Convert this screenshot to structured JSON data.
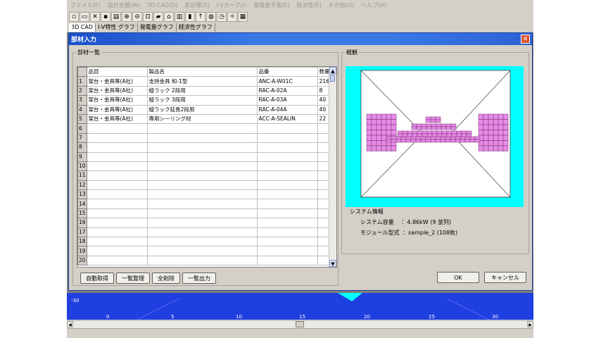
{
  "menu": [
    "ファイル(F)",
    "設計支援(W)",
    "3D CAD(D)",
    "影計算(S)",
    "I-Vカーブ(I)",
    "発電量予測(E)",
    "経済性(E)",
    "その他(O)",
    "ヘルプ(H)"
  ],
  "tabs": [
    "3D CAD",
    "I-V特性 グラフ",
    "発電量グラフ",
    "経済性グラフ"
  ],
  "dialog": {
    "title": "部材入力",
    "close_glyph": "✕",
    "parts_legend": "部材一覧",
    "overview_legend": "概観",
    "columns": [
      "品目",
      "製品名",
      "品番",
      "数量"
    ],
    "rows": [
      {
        "no": "1",
        "item": "架台・金具等(A社)",
        "name": "支持金具 和-1型",
        "code": "ANC-A-W01C",
        "qty": "216"
      },
      {
        "no": "2",
        "item": "架台・金具等(A社)",
        "name": "縦ラック 2段用",
        "code": "RAC-A-02A",
        "qty": "8"
      },
      {
        "no": "3",
        "item": "架台・金具等(A社)",
        "name": "縦ラック 3段用",
        "code": "RAC-A-03A",
        "qty": "40"
      },
      {
        "no": "4",
        "item": "架台・金具等(A社)",
        "name": "縦ラック延長2段用",
        "code": "RAC-A-04A",
        "qty": "40"
      },
      {
        "no": "5",
        "item": "架台・金具等(A社)",
        "name": "専用シーリング材",
        "code": "ACC-A-SEALIN",
        "qty": "22"
      },
      {
        "no": "6",
        "item": "",
        "name": "",
        "code": "",
        "qty": ""
      },
      {
        "no": "7",
        "item": "",
        "name": "",
        "code": "",
        "qty": ""
      },
      {
        "no": "8",
        "item": "",
        "name": "",
        "code": "",
        "qty": ""
      },
      {
        "no": "9",
        "item": "",
        "name": "",
        "code": "",
        "qty": ""
      },
      {
        "no": "10",
        "item": "",
        "name": "",
        "code": "",
        "qty": ""
      },
      {
        "no": "11",
        "item": "",
        "name": "",
        "code": "",
        "qty": ""
      },
      {
        "no": "12",
        "item": "",
        "name": "",
        "code": "",
        "qty": ""
      },
      {
        "no": "13",
        "item": "",
        "name": "",
        "code": "",
        "qty": ""
      },
      {
        "no": "14",
        "item": "",
        "name": "",
        "code": "",
        "qty": ""
      },
      {
        "no": "15",
        "item": "",
        "name": "",
        "code": "",
        "qty": ""
      },
      {
        "no": "16",
        "item": "",
        "name": "",
        "code": "",
        "qty": ""
      },
      {
        "no": "17",
        "item": "",
        "name": "",
        "code": "",
        "qty": ""
      },
      {
        "no": "18",
        "item": "",
        "name": "",
        "code": "",
        "qty": ""
      },
      {
        "no": "19",
        "item": "",
        "name": "",
        "code": "",
        "qty": ""
      },
      {
        "no": "20",
        "item": "",
        "name": "",
        "code": "",
        "qty": ""
      }
    ],
    "buttons": {
      "auto": "自動取得",
      "sort": "一覧整理",
      "delete_all": "全削除",
      "export": "一覧出力",
      "ok": "OK",
      "cancel": "キャンセル"
    },
    "system_info": {
      "heading": "システム情報",
      "capacity_label": "システム容量",
      "capacity_value": "：4.86kW (9 並列)",
      "module_label": "モジュール型式",
      "module_value": "：sample_2 (108枚)"
    }
  },
  "graph": {
    "ticks": [
      "-30",
      "0",
      "5",
      "10",
      "15",
      "20",
      "25",
      "30"
    ]
  },
  "colors": {
    "roof_bg": "#00ffff",
    "panel_fill": "#e58ce5",
    "panel_line": "#7a2a7a",
    "graph_bg": "#1f3fe0"
  }
}
